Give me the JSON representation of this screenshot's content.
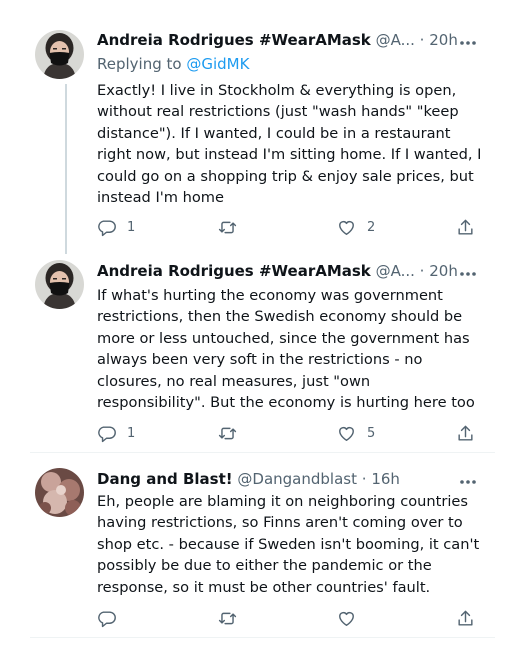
{
  "tweets": [
    {
      "name": "Andreia Rodrigues #WearAMask",
      "handle": "@A...",
      "separator": "·",
      "time": "20h",
      "replying_prefix": "Replying to ",
      "replying_handle": "@GidMK",
      "text": "Exactly! I live in Stockholm & everything is open, without real restrictions (just \"wash hands\" \"keep distance\"). If I wanted, I could be in a restaurant right now, but instead I'm sitting home. If I wanted, I could go on a shopping trip & enjoy sale prices, but instead I'm home",
      "reply_count": "1",
      "retweet_count": "",
      "like_count": "2"
    },
    {
      "name": "Andreia Rodrigues #WearAMask",
      "handle": "@A...",
      "separator": "·",
      "time": "20h",
      "text": "If what's hurting the economy was government restrictions, then the Swedish economy should be more or less untouched, since the government has always been very soft in the restrictions - no closures, no real measures, just \"own responsibility\". But the economy is hurting here too",
      "reply_count": "1",
      "retweet_count": "",
      "like_count": "5"
    },
    {
      "name": "Dang and Blast!",
      "handle": "@Dangandblast",
      "separator": "·",
      "time": "16h",
      "text": "Eh, people are blaming it on neighboring countries having restrictions, so Finns aren't coming over to shop etc. - because if Sweden isn't booming, it can't possibly be due to either the pandemic or the response, so it must be other countries' fault.",
      "reply_count": "",
      "retweet_count": "",
      "like_count": ""
    }
  ],
  "icons": {
    "reply": "reply-icon",
    "retweet": "retweet-icon",
    "like": "heart-icon",
    "share": "share-icon",
    "more": "more-icon"
  },
  "colors": {
    "link": "#1d9bf0",
    "secondary_text": "#536471",
    "thread_line": "#cfd9de"
  }
}
